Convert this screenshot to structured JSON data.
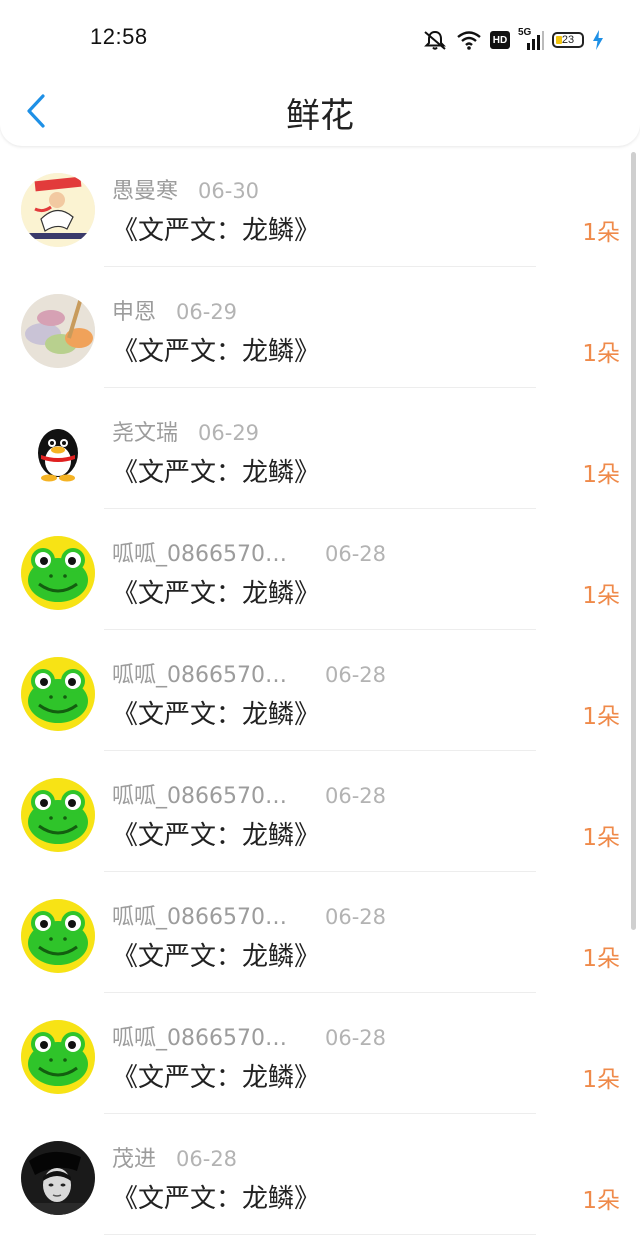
{
  "status_bar": {
    "time": "12:58",
    "network_label": "5G",
    "hd_label": "HD",
    "battery": "23",
    "icons": [
      "mute-bell-icon",
      "wifi-icon",
      "hd-icon",
      "signal-icon",
      "battery-icon",
      "charging-icon"
    ]
  },
  "header": {
    "title": "鲜花",
    "back_icon": "chevron-left-icon"
  },
  "colors": {
    "accent": "#1e90e6",
    "flower_count": "#ef8a4a",
    "name_gray": "#9c9c9c"
  },
  "list": [
    {
      "name": "愚曼寒",
      "date": "06-30",
      "book": "《文严文：龙鳞》",
      "count": "1朵",
      "avatar": "cartoon-avatar"
    },
    {
      "name": "申恩",
      "date": "06-29",
      "book": "《文严文：龙鳞》",
      "count": "1朵",
      "avatar": "photo-avatar"
    },
    {
      "name": "尧文瑞",
      "date": "06-29",
      "book": "《文严文：龙鳞》",
      "count": "1朵",
      "avatar": "penguin-avatar"
    },
    {
      "name": "呱呱_08665706...",
      "date": "06-28",
      "book": "《文严文：龙鳞》",
      "count": "1朵",
      "avatar": "frog-avatar"
    },
    {
      "name": "呱呱_08665706...",
      "date": "06-28",
      "book": "《文严文：龙鳞》",
      "count": "1朵",
      "avatar": "frog-avatar"
    },
    {
      "name": "呱呱_08665706...",
      "date": "06-28",
      "book": "《文严文：龙鳞》",
      "count": "1朵",
      "avatar": "frog-avatar"
    },
    {
      "name": "呱呱_08665706...",
      "date": "06-28",
      "book": "《文严文：龙鳞》",
      "count": "1朵",
      "avatar": "frog-avatar"
    },
    {
      "name": "呱呱_08665706...",
      "date": "06-28",
      "book": "《文严文：龙鳞》",
      "count": "1朵",
      "avatar": "frog-avatar"
    },
    {
      "name": "茂进",
      "date": "06-28",
      "book": "《文严文：龙鳞》",
      "count": "1朵",
      "avatar": "bw-photo-avatar"
    }
  ]
}
